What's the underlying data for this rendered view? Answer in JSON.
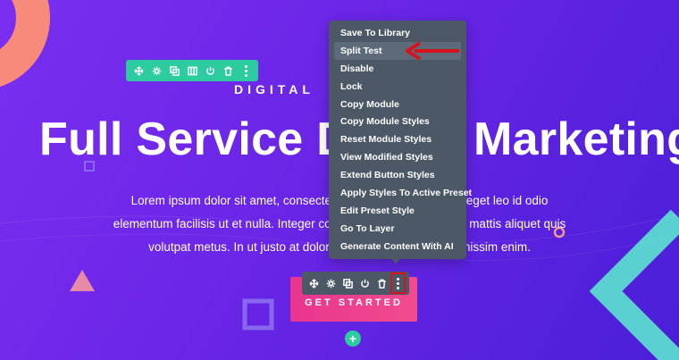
{
  "hero": {
    "eyebrow": "DIGITAL",
    "headline": "Full Service Digital Marketing",
    "body_lines": [
      "Lorem ipsum dolor sit amet, consectetur adipiscing elit. Donec eget leo id odio",
      "elementum facilisis ut et nulla. Integer consectetur rhoncus massa mattis aliquet quis",
      "volutpat metus. In ut justo at dolor tempor vehicula a ac dignissim enim."
    ],
    "cta_label": "GET STARTED"
  },
  "context_menu": {
    "items": [
      "Save To Library",
      "Split Test",
      "Disable",
      "Lock",
      "Copy Module",
      "Copy Module Styles",
      "Reset Module Styles",
      "View Modified Styles",
      "Extend Button Styles",
      "Apply Styles To Active Preset",
      "Edit Preset Style",
      "Go To Layer",
      "Generate Content With AI"
    ],
    "highlighted": "Split Test"
  },
  "row_toolbar": {
    "icons": [
      "move-icon",
      "gear-icon",
      "duplicate-icon",
      "columns-icon",
      "power-icon",
      "trash-icon",
      "more-icon"
    ]
  },
  "module_toolbar": {
    "icons": [
      "move-icon",
      "gear-icon",
      "duplicate-icon",
      "power-icon",
      "trash-icon",
      "more-icon"
    ]
  },
  "add_button": {
    "label": "+"
  },
  "colors": {
    "background": "#6a25e6",
    "row_toolbar": "#2dcba0",
    "module_toolbar": "#4c5866",
    "cta_gradient_start": "#e8358f",
    "annotation_red": "#d8121b",
    "coral": "#f78a7a",
    "teal": "#5ad0d0"
  }
}
